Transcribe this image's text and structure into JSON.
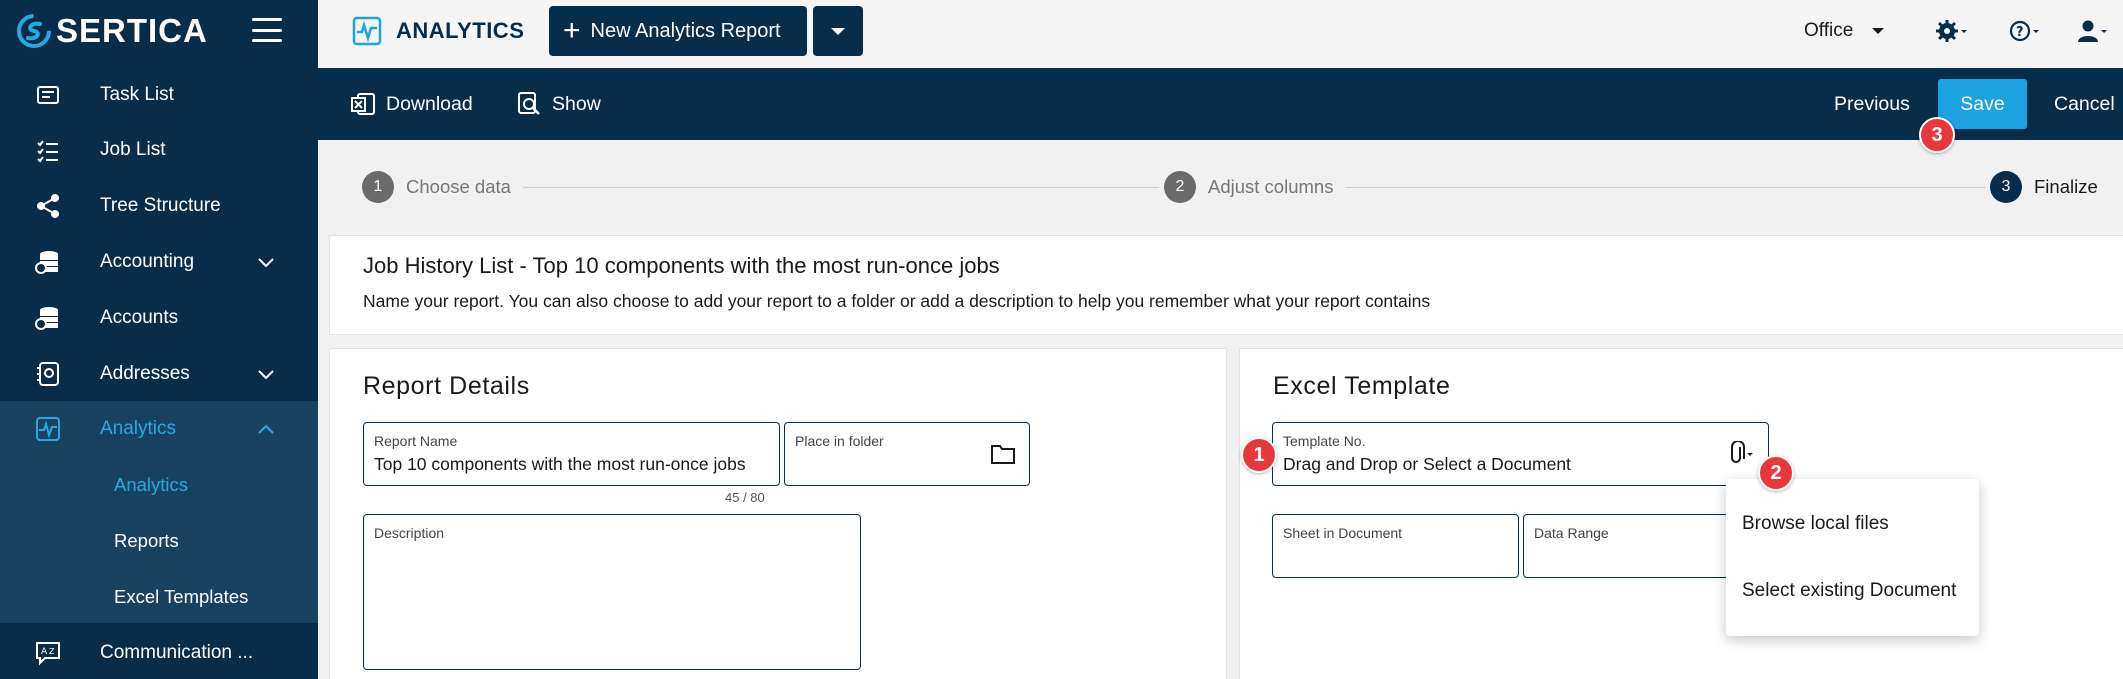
{
  "brand": {
    "name": "SERTICA"
  },
  "sidebar": {
    "items": [
      {
        "label": "Task List",
        "icon": "task-list-icon"
      },
      {
        "label": "Job List",
        "icon": "job-list-icon"
      },
      {
        "label": "Tree Structure",
        "icon": "tree-structure-icon"
      },
      {
        "label": "Accounting",
        "icon": "accounting-icon",
        "expandable": true
      },
      {
        "label": "Accounts",
        "icon": "accounts-icon"
      },
      {
        "label": "Addresses",
        "icon": "addresses-icon",
        "expandable": true
      },
      {
        "label": "Analytics",
        "icon": "analytics-icon",
        "expanded": true,
        "active": true
      },
      {
        "label": "Communication ...",
        "icon": "communication-icon"
      }
    ],
    "sub_items": [
      {
        "label": "Analytics",
        "active": true
      },
      {
        "label": "Reports"
      },
      {
        "label": "Excel Templates"
      }
    ]
  },
  "header": {
    "app_title": "ANALYTICS",
    "new_button": "New Analytics Report",
    "office": "Office"
  },
  "toolbar": {
    "download": "Download",
    "show": "Show",
    "previous": "Previous",
    "save": "Save",
    "cancel": "Cancel"
  },
  "stepper": {
    "steps": [
      {
        "number": "1",
        "label": "Choose data"
      },
      {
        "number": "2",
        "label": "Adjust columns"
      },
      {
        "number": "3",
        "label": "Finalize",
        "current": true
      }
    ]
  },
  "intro": {
    "title": "Job History List - Top 10 components with the most run-once jobs",
    "description": "Name your report. You can also choose to add your report to a folder or add a description to help you remember what your report contains"
  },
  "report_details": {
    "title": "Report Details",
    "report_name_label": "Report Name",
    "report_name_value": "Top 10 components with the most run-once jobs",
    "counter": "45 / 80",
    "place_in_folder_label": "Place in folder",
    "description_label": "Description"
  },
  "excel_template": {
    "title": "Excel Template",
    "template_no_label": "Template No.",
    "template_no_value": "Drag and Drop or Select a Document",
    "sheet_label": "Sheet in Document",
    "data_range_label": "Data Range"
  },
  "menu": {
    "items": [
      "Browse local files",
      "Select existing Document"
    ]
  },
  "badges": [
    "1",
    "2",
    "3"
  ],
  "colors": {
    "navy": "#082d4b",
    "accent": "#1aa3e0",
    "active_text": "#28a8e0",
    "badge": "#e8383d"
  }
}
